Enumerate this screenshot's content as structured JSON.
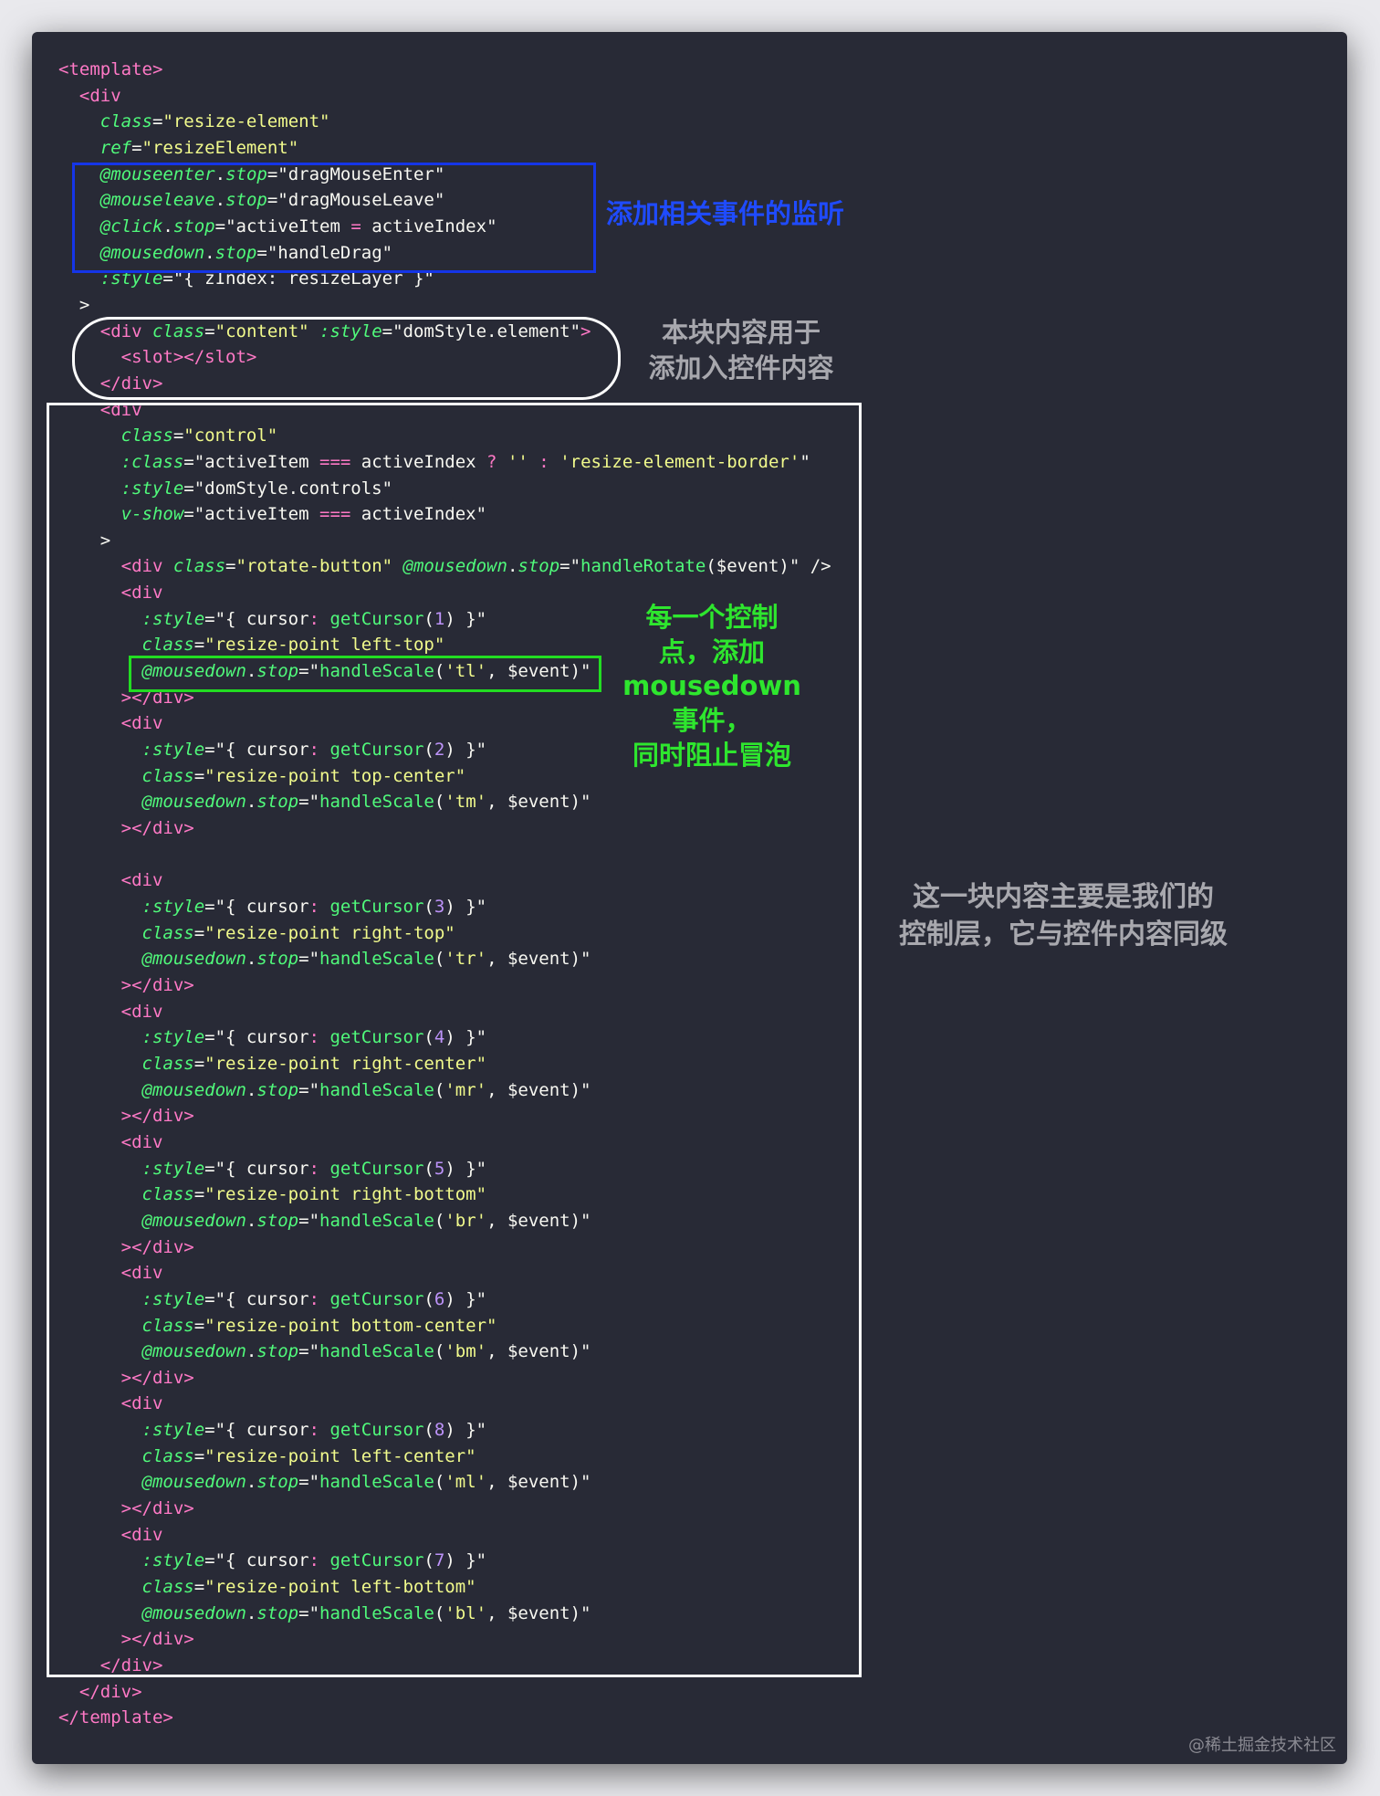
{
  "code_lines": [
    [
      [
        "tag",
        "<template>"
      ]
    ],
    [
      [
        "pl",
        "  "
      ],
      [
        "tag",
        "<div"
      ]
    ],
    [
      [
        "pl",
        "    "
      ],
      [
        "attr",
        "class"
      ],
      [
        "pl",
        "="
      ],
      [
        "str",
        "\"resize-element\""
      ]
    ],
    [
      [
        "pl",
        "    "
      ],
      [
        "attr",
        "ref"
      ],
      [
        "pl",
        "="
      ],
      [
        "str",
        "\"resizeElement\""
      ]
    ],
    [
      [
        "pl",
        "    "
      ],
      [
        "attr",
        "@mouseenter"
      ],
      [
        "pl",
        "."
      ],
      [
        "attr",
        "stop"
      ],
      [
        "pl",
        "=\""
      ],
      [
        "pl",
        "dragMouseEnter"
      ],
      [
        "pl",
        "\""
      ]
    ],
    [
      [
        "pl",
        "    "
      ],
      [
        "attr",
        "@mouseleave"
      ],
      [
        "pl",
        "."
      ],
      [
        "attr",
        "stop"
      ],
      [
        "pl",
        "=\""
      ],
      [
        "pl",
        "dragMouseLeave"
      ],
      [
        "pl",
        "\""
      ]
    ],
    [
      [
        "pl",
        "    "
      ],
      [
        "attr",
        "@click"
      ],
      [
        "pl",
        "."
      ],
      [
        "attr",
        "stop"
      ],
      [
        "pl",
        "=\""
      ],
      [
        "pl",
        "activeItem"
      ],
      [
        "op",
        " = "
      ],
      [
        "pl",
        "activeIndex"
      ],
      [
        "pl",
        "\""
      ]
    ],
    [
      [
        "pl",
        "    "
      ],
      [
        "attr",
        "@mousedown"
      ],
      [
        "pl",
        "."
      ],
      [
        "attr",
        "stop"
      ],
      [
        "pl",
        "=\""
      ],
      [
        "pl",
        "handleDrag"
      ],
      [
        "pl",
        "\""
      ]
    ],
    [
      [
        "pl",
        "    "
      ],
      [
        "attr",
        ":style"
      ],
      [
        "pl",
        "=\"{ zIndex: resizeLayer }\""
      ]
    ],
    [
      [
        "pl",
        "  >"
      ]
    ],
    [
      [
        "pl",
        "    "
      ],
      [
        "tag",
        "<div "
      ],
      [
        "attr",
        "class"
      ],
      [
        "pl",
        "="
      ],
      [
        "str",
        "\"content\""
      ],
      [
        "pl",
        " "
      ],
      [
        "attr",
        ":style"
      ],
      [
        "pl",
        "=\"domStyle.element\""
      ],
      [
        "tag",
        ">"
      ]
    ],
    [
      [
        "pl",
        "      "
      ],
      [
        "tag",
        "<slot></slot>"
      ]
    ],
    [
      [
        "pl",
        "    "
      ],
      [
        "tag",
        "</div>"
      ]
    ],
    [
      [
        "pl",
        "    "
      ],
      [
        "tag",
        "<div"
      ]
    ],
    [
      [
        "pl",
        "      "
      ],
      [
        "attr",
        "class"
      ],
      [
        "pl",
        "="
      ],
      [
        "str",
        "\"control\""
      ]
    ],
    [
      [
        "pl",
        "      "
      ],
      [
        "attr",
        ":class"
      ],
      [
        "pl",
        "=\"activeItem "
      ],
      [
        "op",
        "==="
      ],
      [
        "pl",
        " activeIndex "
      ],
      [
        "op",
        "?"
      ],
      [
        "pl",
        " "
      ],
      [
        "str",
        "''"
      ],
      [
        "pl",
        " "
      ],
      [
        "op",
        ":"
      ],
      [
        "pl",
        " "
      ],
      [
        "str",
        "'resize-element-border'"
      ],
      [
        "pl",
        "\""
      ]
    ],
    [
      [
        "pl",
        "      "
      ],
      [
        "attr",
        ":style"
      ],
      [
        "pl",
        "=\"domStyle.controls\""
      ]
    ],
    [
      [
        "pl",
        "      "
      ],
      [
        "attr",
        "v-show"
      ],
      [
        "pl",
        "=\"activeItem "
      ],
      [
        "op",
        "==="
      ],
      [
        "pl",
        " activeIndex\""
      ]
    ],
    [
      [
        "pl",
        "    >"
      ]
    ],
    [
      [
        "pl",
        "      "
      ],
      [
        "tag",
        "<div "
      ],
      [
        "attr",
        "class"
      ],
      [
        "pl",
        "="
      ],
      [
        "str",
        "\"rotate-button\""
      ],
      [
        "pl",
        " "
      ],
      [
        "attr",
        "@mousedown"
      ],
      [
        "pl",
        "."
      ],
      [
        "attr",
        "stop"
      ],
      [
        "pl",
        "=\""
      ],
      [
        "fn",
        "handleRotate"
      ],
      [
        "pl",
        "($event)\" />"
      ]
    ],
    [
      [
        "pl",
        "      "
      ],
      [
        "tag",
        "<div"
      ]
    ],
    [
      [
        "pl",
        "        "
      ],
      [
        "attr",
        ":style"
      ],
      [
        "pl",
        "=\"{ cursor"
      ],
      [
        "op",
        ":"
      ],
      [
        "pl",
        " "
      ],
      [
        "fn",
        "getCursor"
      ],
      [
        "pl",
        "("
      ],
      [
        "num",
        "1"
      ],
      [
        "pl",
        ") }\""
      ]
    ],
    [
      [
        "pl",
        "        "
      ],
      [
        "attr",
        "class"
      ],
      [
        "pl",
        "="
      ],
      [
        "str",
        "\"resize-point left-top\""
      ]
    ],
    [
      [
        "pl",
        "        "
      ],
      [
        "attr",
        "@mousedown"
      ],
      [
        "pl",
        "."
      ],
      [
        "attr",
        "stop"
      ],
      [
        "pl",
        "=\""
      ],
      [
        "fn",
        "handleScale"
      ],
      [
        "pl",
        "("
      ],
      [
        "str",
        "'tl'"
      ],
      [
        "pl",
        ", $event)\""
      ]
    ],
    [
      [
        "pl",
        "      "
      ],
      [
        "tag",
        "></div>"
      ]
    ],
    [
      [
        "pl",
        "      "
      ],
      [
        "tag",
        "<div"
      ]
    ],
    [
      [
        "pl",
        "        "
      ],
      [
        "attr",
        ":style"
      ],
      [
        "pl",
        "=\"{ cursor"
      ],
      [
        "op",
        ":"
      ],
      [
        "pl",
        " "
      ],
      [
        "fn",
        "getCursor"
      ],
      [
        "pl",
        "("
      ],
      [
        "num",
        "2"
      ],
      [
        "pl",
        ") }\""
      ]
    ],
    [
      [
        "pl",
        "        "
      ],
      [
        "attr",
        "class"
      ],
      [
        "pl",
        "="
      ],
      [
        "str",
        "\"resize-point top-center\""
      ]
    ],
    [
      [
        "pl",
        "        "
      ],
      [
        "attr",
        "@mousedown"
      ],
      [
        "pl",
        "."
      ],
      [
        "attr",
        "stop"
      ],
      [
        "pl",
        "=\""
      ],
      [
        "fn",
        "handleScale"
      ],
      [
        "pl",
        "("
      ],
      [
        "str",
        "'tm'"
      ],
      [
        "pl",
        ", $event)\""
      ]
    ],
    [
      [
        "pl",
        "      "
      ],
      [
        "tag",
        "></div>"
      ]
    ],
    [
      [
        "pl",
        ""
      ]
    ],
    [
      [
        "pl",
        "      "
      ],
      [
        "tag",
        "<div"
      ]
    ],
    [
      [
        "pl",
        "        "
      ],
      [
        "attr",
        ":style"
      ],
      [
        "pl",
        "=\"{ cursor"
      ],
      [
        "op",
        ":"
      ],
      [
        "pl",
        " "
      ],
      [
        "fn",
        "getCursor"
      ],
      [
        "pl",
        "("
      ],
      [
        "num",
        "3"
      ],
      [
        "pl",
        ") }\""
      ]
    ],
    [
      [
        "pl",
        "        "
      ],
      [
        "attr",
        "class"
      ],
      [
        "pl",
        "="
      ],
      [
        "str",
        "\"resize-point right-top\""
      ]
    ],
    [
      [
        "pl",
        "        "
      ],
      [
        "attr",
        "@mousedown"
      ],
      [
        "pl",
        "."
      ],
      [
        "attr",
        "stop"
      ],
      [
        "pl",
        "=\""
      ],
      [
        "fn",
        "handleScale"
      ],
      [
        "pl",
        "("
      ],
      [
        "str",
        "'tr'"
      ],
      [
        "pl",
        ", $event)\""
      ]
    ],
    [
      [
        "pl",
        "      "
      ],
      [
        "tag",
        "></div>"
      ]
    ],
    [
      [
        "pl",
        "      "
      ],
      [
        "tag",
        "<div"
      ]
    ],
    [
      [
        "pl",
        "        "
      ],
      [
        "attr",
        ":style"
      ],
      [
        "pl",
        "=\"{ cursor"
      ],
      [
        "op",
        ":"
      ],
      [
        "pl",
        " "
      ],
      [
        "fn",
        "getCursor"
      ],
      [
        "pl",
        "("
      ],
      [
        "num",
        "4"
      ],
      [
        "pl",
        ") }\""
      ]
    ],
    [
      [
        "pl",
        "        "
      ],
      [
        "attr",
        "class"
      ],
      [
        "pl",
        "="
      ],
      [
        "str",
        "\"resize-point right-center\""
      ]
    ],
    [
      [
        "pl",
        "        "
      ],
      [
        "attr",
        "@mousedown"
      ],
      [
        "pl",
        "."
      ],
      [
        "attr",
        "stop"
      ],
      [
        "pl",
        "=\""
      ],
      [
        "fn",
        "handleScale"
      ],
      [
        "pl",
        "("
      ],
      [
        "str",
        "'mr'"
      ],
      [
        "pl",
        ", $event)\""
      ]
    ],
    [
      [
        "pl",
        "      "
      ],
      [
        "tag",
        "></div>"
      ]
    ],
    [
      [
        "pl",
        "      "
      ],
      [
        "tag",
        "<div"
      ]
    ],
    [
      [
        "pl",
        "        "
      ],
      [
        "attr",
        ":style"
      ],
      [
        "pl",
        "=\"{ cursor"
      ],
      [
        "op",
        ":"
      ],
      [
        "pl",
        " "
      ],
      [
        "fn",
        "getCursor"
      ],
      [
        "pl",
        "("
      ],
      [
        "num",
        "5"
      ],
      [
        "pl",
        ") }\""
      ]
    ],
    [
      [
        "pl",
        "        "
      ],
      [
        "attr",
        "class"
      ],
      [
        "pl",
        "="
      ],
      [
        "str",
        "\"resize-point right-bottom\""
      ]
    ],
    [
      [
        "pl",
        "        "
      ],
      [
        "attr",
        "@mousedown"
      ],
      [
        "pl",
        "."
      ],
      [
        "attr",
        "stop"
      ],
      [
        "pl",
        "=\""
      ],
      [
        "fn",
        "handleScale"
      ],
      [
        "pl",
        "("
      ],
      [
        "str",
        "'br'"
      ],
      [
        "pl",
        ", $event)\""
      ]
    ],
    [
      [
        "pl",
        "      "
      ],
      [
        "tag",
        "></div>"
      ]
    ],
    [
      [
        "pl",
        "      "
      ],
      [
        "tag",
        "<div"
      ]
    ],
    [
      [
        "pl",
        "        "
      ],
      [
        "attr",
        ":style"
      ],
      [
        "pl",
        "=\"{ cursor"
      ],
      [
        "op",
        ":"
      ],
      [
        "pl",
        " "
      ],
      [
        "fn",
        "getCursor"
      ],
      [
        "pl",
        "("
      ],
      [
        "num",
        "6"
      ],
      [
        "pl",
        ") }\""
      ]
    ],
    [
      [
        "pl",
        "        "
      ],
      [
        "attr",
        "class"
      ],
      [
        "pl",
        "="
      ],
      [
        "str",
        "\"resize-point bottom-center\""
      ]
    ],
    [
      [
        "pl",
        "        "
      ],
      [
        "attr",
        "@mousedown"
      ],
      [
        "pl",
        "."
      ],
      [
        "attr",
        "stop"
      ],
      [
        "pl",
        "=\""
      ],
      [
        "fn",
        "handleScale"
      ],
      [
        "pl",
        "("
      ],
      [
        "str",
        "'bm'"
      ],
      [
        "pl",
        ", $event)\""
      ]
    ],
    [
      [
        "pl",
        "      "
      ],
      [
        "tag",
        "></div>"
      ]
    ],
    [
      [
        "pl",
        "      "
      ],
      [
        "tag",
        "<div"
      ]
    ],
    [
      [
        "pl",
        "        "
      ],
      [
        "attr",
        ":style"
      ],
      [
        "pl",
        "=\"{ cursor"
      ],
      [
        "op",
        ":"
      ],
      [
        "pl",
        " "
      ],
      [
        "fn",
        "getCursor"
      ],
      [
        "pl",
        "("
      ],
      [
        "num",
        "8"
      ],
      [
        "pl",
        ") }\""
      ]
    ],
    [
      [
        "pl",
        "        "
      ],
      [
        "attr",
        "class"
      ],
      [
        "pl",
        "="
      ],
      [
        "str",
        "\"resize-point left-center\""
      ]
    ],
    [
      [
        "pl",
        "        "
      ],
      [
        "attr",
        "@mousedown"
      ],
      [
        "pl",
        "."
      ],
      [
        "attr",
        "stop"
      ],
      [
        "pl",
        "=\""
      ],
      [
        "fn",
        "handleScale"
      ],
      [
        "pl",
        "("
      ],
      [
        "str",
        "'ml'"
      ],
      [
        "pl",
        ", $event)\""
      ]
    ],
    [
      [
        "pl",
        "      "
      ],
      [
        "tag",
        "></div>"
      ]
    ],
    [
      [
        "pl",
        "      "
      ],
      [
        "tag",
        "<div"
      ]
    ],
    [
      [
        "pl",
        "        "
      ],
      [
        "attr",
        ":style"
      ],
      [
        "pl",
        "=\"{ cursor"
      ],
      [
        "op",
        ":"
      ],
      [
        "pl",
        " "
      ],
      [
        "fn",
        "getCursor"
      ],
      [
        "pl",
        "("
      ],
      [
        "num",
        "7"
      ],
      [
        "pl",
        ") }\""
      ]
    ],
    [
      [
        "pl",
        "        "
      ],
      [
        "attr",
        "class"
      ],
      [
        "pl",
        "="
      ],
      [
        "str",
        "\"resize-point left-bottom\""
      ]
    ],
    [
      [
        "pl",
        "        "
      ],
      [
        "attr",
        "@mousedown"
      ],
      [
        "pl",
        "."
      ],
      [
        "attr",
        "stop"
      ],
      [
        "pl",
        "=\""
      ],
      [
        "fn",
        "handleScale"
      ],
      [
        "pl",
        "("
      ],
      [
        "str",
        "'bl'"
      ],
      [
        "pl",
        ", $event)\""
      ]
    ],
    [
      [
        "pl",
        "      "
      ],
      [
        "tag",
        "></div>"
      ]
    ],
    [
      [
        "pl",
        "    "
      ],
      [
        "tag",
        "</div>"
      ]
    ],
    [
      [
        "pl",
        "  "
      ],
      [
        "tag",
        "</div>"
      ]
    ],
    [
      [
        "tag",
        "</template>"
      ]
    ]
  ],
  "annotations": {
    "listeners": "添加相关事件的监听",
    "content_block": "本块内容用于\n添加入控件内容",
    "control_point": "每一个控制\n点，添加\nmousedown\n事件，\n同时阻止冒泡",
    "control_layer": "这一块内容主要是我们的\n控制层，它与控件内容同级"
  },
  "watermark": "@稀土掘金技术社区",
  "colors": {
    "panel_background": "#282a36",
    "tag": "#ff79c6",
    "attribute": "#50fa7b",
    "string": "#f1fa8c",
    "number": "#bd93f9",
    "plain": "#f8f8f2",
    "box_blue": "#1535e8",
    "box_white": "#ffffff",
    "box_green": "#22dd22"
  }
}
